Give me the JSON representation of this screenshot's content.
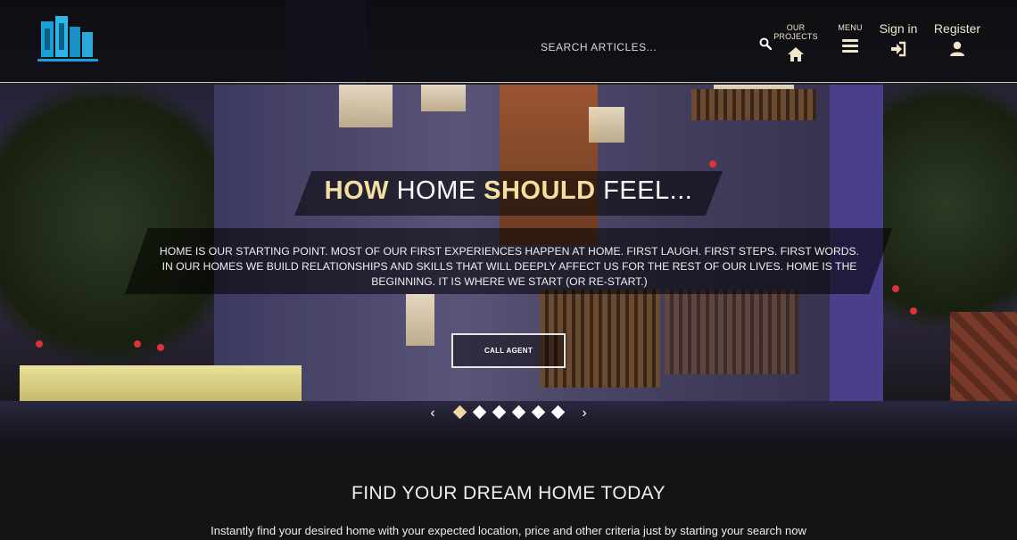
{
  "header": {
    "search_placeholder": "SEARCH ARTICLES...",
    "nav": {
      "projects_label": "OUR PROJECTS",
      "menu_label": "MENU",
      "signin_label": "Sign in",
      "register_label": "Register"
    }
  },
  "hero": {
    "headline_part1": "HOW",
    "headline_part2": " HOME ",
    "headline_part3": "SHOULD",
    "headline_part4": " FEEL...",
    "subtext": "HOME IS OUR STARTING POINT. MOST OF OUR FIRST EXPERIENCES HAPPEN AT HOME. FIRST LAUGH. FIRST STEPS. FIRST WORDS. IN OUR HOMES WE BUILD RELATIONSHIPS AND SKILLS THAT WILL DEEPLY AFFECT US FOR THE REST OF OUR LIVES. HOME IS THE BEGINNING. IT IS WHERE WE START (OR RE-START.)",
    "cta_label": "CALL AGENT",
    "prev_glyph": "‹",
    "next_glyph": "›",
    "slide_count": 6,
    "active_slide": 1
  },
  "section": {
    "title": "FIND YOUR DREAM HOME TODAY",
    "subtitle": "Instantly find your desired home with your expected location, price and other criteria just by starting your search now"
  },
  "colors": {
    "accent": "#f0d8a0",
    "logo_blue": "#1aa0d8"
  },
  "icons": [
    "logo-icon",
    "search-icon",
    "home-icon",
    "menu-icon",
    "sign-in-icon",
    "user-icon"
  ]
}
